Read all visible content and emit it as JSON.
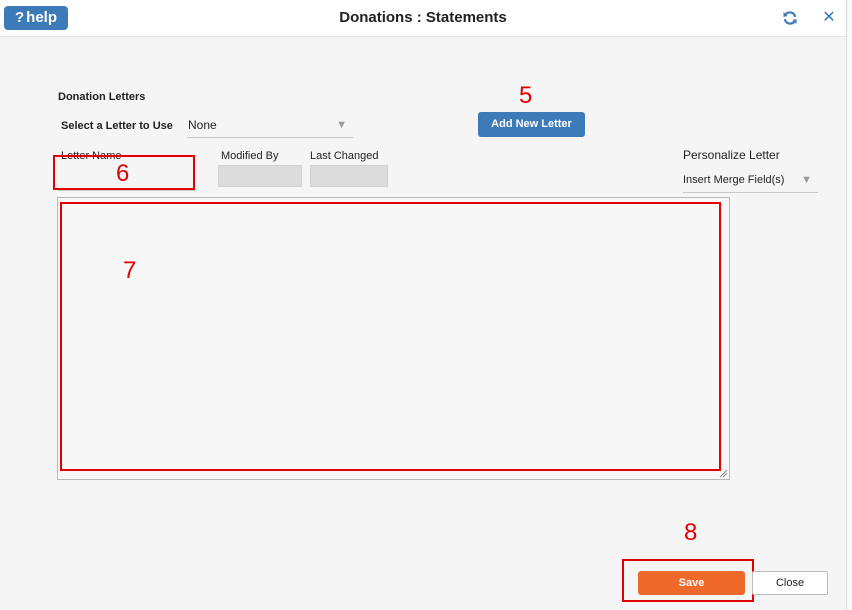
{
  "window": {
    "title": "Donations : Statements",
    "help_label": "help",
    "help_glyph": "?"
  },
  "form": {
    "section_title": "Donation Letters",
    "select_letter_label": "Select a Letter to Use",
    "select_letter_value": "None",
    "add_new_letter_label": "Add New Letter",
    "letter_name_label": "Letter Name",
    "modified_by_label": "Modified By",
    "last_changed_label": "Last Changed",
    "personalize_label": "Personalize Letter",
    "merge_field_value": "Insert Merge Field(s)",
    "letter_name_value": "",
    "modified_by_value": "",
    "last_changed_value": "",
    "letter_body_value": ""
  },
  "footer": {
    "save_label": "Save",
    "close_label": "Close"
  },
  "annotations": {
    "n5": "5",
    "n6": "6",
    "n7": "7",
    "n8": "8"
  },
  "colors": {
    "primary_blue": "#3d7ab8",
    "save_orange": "#ef6a2a",
    "annotation_red": "#e00000"
  },
  "icons": {
    "refresh": "refresh-icon",
    "close": "close-icon",
    "caret": "caret-down-icon",
    "help": "question-icon"
  }
}
